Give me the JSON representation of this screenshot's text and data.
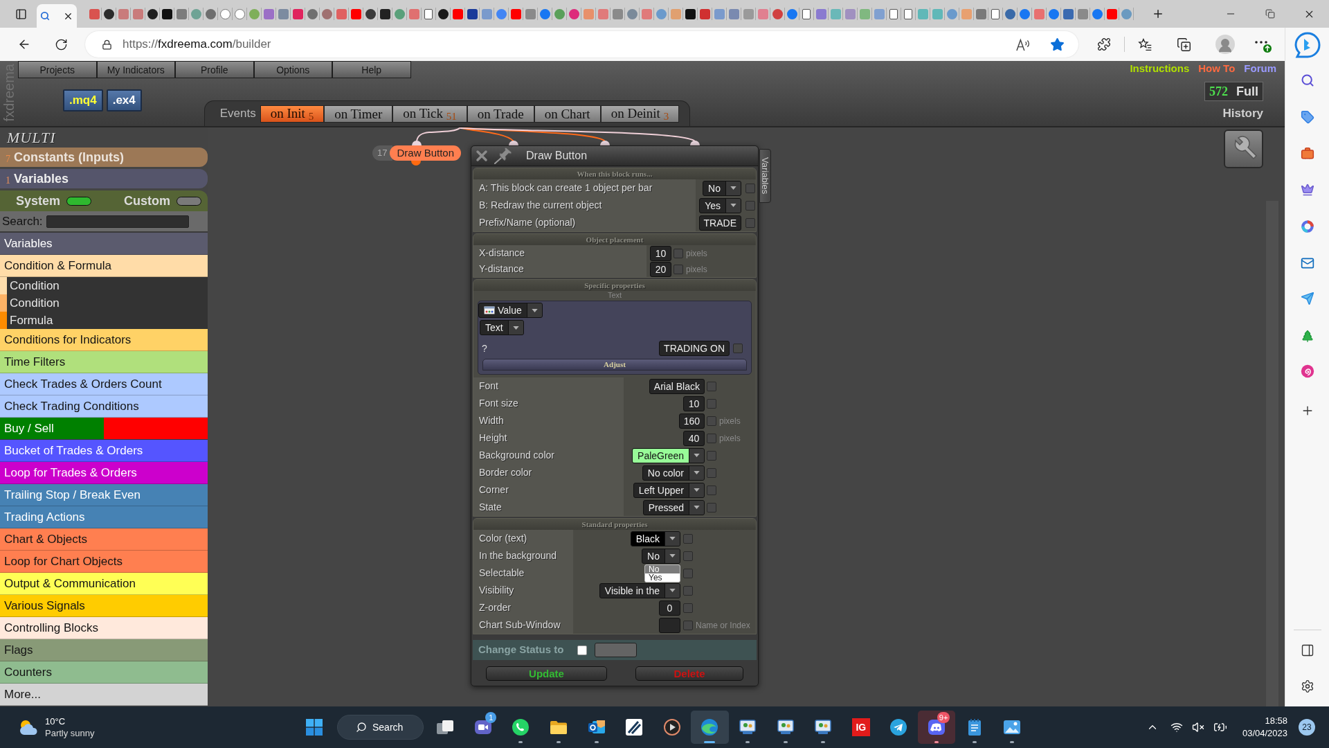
{
  "browser": {
    "favorited": true,
    "address": {
      "scheme": "https://",
      "host": "fxdreema.com",
      "path": "/builder"
    }
  },
  "header": {
    "brand": "fxdreema",
    "menu": [
      "Projects",
      "My Indicators",
      "Profile",
      "Options",
      "Help"
    ],
    "file_buttons": [
      {
        "label": ".mq4",
        "kind": "source"
      },
      {
        "label": ".ex4",
        "kind": "binary"
      }
    ],
    "links": [
      {
        "label": "Instructions",
        "color": "#b0e000"
      },
      {
        "label": "How To",
        "color": "#ff6a40"
      },
      {
        "label": "Forum",
        "color": "#9a9aff"
      }
    ],
    "counter": {
      "value": "572",
      "label": "Full"
    },
    "history": "History"
  },
  "events": {
    "label": "Events",
    "tabs": [
      {
        "label": "on Init",
        "count": "5",
        "selected": true
      },
      {
        "label": "on Timer",
        "selected": false
      },
      {
        "label": "on Tick",
        "count": "51",
        "selected": false
      },
      {
        "label": "on Trade",
        "selected": false
      },
      {
        "label": "on Chart",
        "selected": false
      },
      {
        "label": "on Deinit",
        "count": "3",
        "selected": false
      }
    ]
  },
  "sidebar": {
    "project": "MULTI",
    "constants": {
      "count": "7",
      "label": "Constants (Inputs)"
    },
    "variables": {
      "count": "1",
      "label": "Variables"
    },
    "toggles": [
      {
        "label": "System",
        "on": true
      },
      {
        "label": "Custom",
        "on": false
      }
    ],
    "search": {
      "label": "Search:"
    },
    "categories": [
      {
        "label": "Variables",
        "color": "#5b5b6e"
      },
      {
        "label": "Condition & Formula",
        "color": "#ffdca8",
        "expanded": true,
        "children": [
          {
            "label": "Condition",
            "color": "#ffdead"
          },
          {
            "label": "Condition",
            "color": "#ffb366"
          },
          {
            "label": "Formula",
            "color": "#ff8c00"
          }
        ]
      },
      {
        "label": "Conditions for Indicators",
        "color": "#ffd266"
      },
      {
        "label": "Time Filters",
        "color": "#b0e07c"
      },
      {
        "label": "Check Trades & Orders Count",
        "color": "#adc9ff"
      },
      {
        "label": "Check Trading Conditions",
        "color": "#adc9ff"
      },
      {
        "label": "Buy / Sell",
        "color": "#008000",
        "split": {
          "color": "#ff0000"
        }
      },
      {
        "label": "Bucket of Trades & Orders",
        "color": "#5555ff"
      },
      {
        "label": "Loop for Trades & Orders",
        "color": "#cc00cc"
      },
      {
        "label": "Trailing Stop / Break Even",
        "color": "#4682b4"
      },
      {
        "label": "Trading Actions",
        "color": "#4682b4"
      },
      {
        "label": "Chart & Objects",
        "color": "#ff7f50"
      },
      {
        "label": "Loop for Chart Objects",
        "color": "#ff7f50"
      },
      {
        "label": "Output & Communication",
        "color": "#ffff55"
      },
      {
        "label": "Various Signals",
        "color": "#ffcc00"
      },
      {
        "label": "Controlling Blocks",
        "color": "#ffe9dc"
      },
      {
        "label": "Flags",
        "color": "#889a77"
      },
      {
        "label": "Counters",
        "color": "#8fbc8f"
      },
      {
        "label": "More...",
        "color": "#d3d3d3"
      }
    ]
  },
  "canvas": {
    "node": {
      "number": "17",
      "label": "Draw Button"
    }
  },
  "dialog": {
    "title": "Draw Button",
    "side_tab": "Variables",
    "sections": [
      {
        "title": "When this block runs...",
        "rows": [
          {
            "kind": "select",
            "label": "A: This block can create 1 object per bar",
            "value": "No",
            "checked": false
          },
          {
            "kind": "select",
            "label": "B: Redraw the current object",
            "value": "Yes",
            "checked": false
          },
          {
            "kind": "input",
            "label": "Prefix/Name (optional)",
            "value": "TRADE",
            "checked": false
          }
        ]
      },
      {
        "title": "Object placement",
        "rows": [
          {
            "kind": "input",
            "label": "X-distance",
            "value": "10",
            "checked": false,
            "unit": "pixels"
          },
          {
            "kind": "input",
            "label": "Y-distance",
            "value": "20",
            "checked": false,
            "unit": "pixels"
          }
        ]
      },
      {
        "title": "Specific properties",
        "subtitle": "Text",
        "value_panel": {
          "source": "Value",
          "type": "Text",
          "hint": "?",
          "value": "TRADING ON",
          "checked": false,
          "adjust": "Adjust"
        },
        "rows": [
          {
            "kind": "input",
            "label": "Font",
            "value": "Arial Black",
            "checked": false
          },
          {
            "kind": "input",
            "label": "Font size",
            "value": "10",
            "checked": false
          },
          {
            "kind": "input",
            "label": "Width",
            "value": "160",
            "checked": false,
            "unit": "pixels"
          },
          {
            "kind": "input",
            "label": "Height",
            "value": "40",
            "checked": false,
            "unit": "pixels"
          },
          {
            "kind": "select",
            "label": "Background color",
            "value": "PaleGreen",
            "color": "#98fb98",
            "checked": false
          },
          {
            "kind": "select",
            "label": "Border color",
            "value": "No color",
            "checked": false
          },
          {
            "kind": "select",
            "label": "Corner",
            "value": "Left Upper",
            "checked": false
          },
          {
            "kind": "select",
            "label": "State",
            "value": "Pressed",
            "checked": false
          }
        ]
      },
      {
        "title": "Standard properties",
        "rows": [
          {
            "kind": "select",
            "label": "Color (text)",
            "value": "Black",
            "color": "#000000",
            "checked": false
          },
          {
            "kind": "select",
            "label": "In the background",
            "value": "No",
            "checked": false
          },
          {
            "kind": "select",
            "label": "Selectable",
            "open": true,
            "options": [
              {
                "label": "No",
                "selected": true
              },
              {
                "label": "Yes",
                "selected": false
              }
            ],
            "checked": false
          },
          {
            "kind": "select",
            "label": "Visibility",
            "value": "Visible in the",
            "checked": false
          },
          {
            "kind": "input",
            "label": "Z-order",
            "value": "0",
            "checked": false
          },
          {
            "kind": "input",
            "label": "Chart Sub-Window",
            "checked": false,
            "unit": "Name or Index"
          }
        ]
      }
    ],
    "change_status": {
      "label": "Change Status to",
      "checked": false
    },
    "buttons": [
      {
        "label": "Update",
        "color": "#33bb33"
      },
      {
        "label": "Delete",
        "color": "#cc1111"
      }
    ]
  },
  "taskbar": {
    "weather": {
      "temperature": "10°C",
      "condition": "Partly sunny"
    },
    "search": "Search",
    "apps": [
      {
        "kind": "taskview",
        "running": false,
        "selected": false,
        "alert": false
      },
      {
        "kind": "teams",
        "running": false,
        "selected": false,
        "alert": false,
        "badge": "1"
      },
      {
        "kind": "whatsapp",
        "running": true,
        "selected": false,
        "alert": false
      },
      {
        "kind": "folder",
        "running": true,
        "selected": false,
        "alert": false
      },
      {
        "kind": "outlook",
        "running": true,
        "selected": false,
        "alert": false
      },
      {
        "kind": "stylus",
        "running": false,
        "selected": false,
        "alert": false
      },
      {
        "kind": "player",
        "running": false,
        "selected": false,
        "alert": false
      },
      {
        "kind": "edge",
        "running": true,
        "selected": true,
        "alert": false
      },
      {
        "kind": "remote",
        "running": true,
        "selected": false,
        "alert": false
      },
      {
        "kind": "remote",
        "running": true,
        "selected": false,
        "alert": false
      },
      {
        "kind": "remote",
        "running": true,
        "selected": false,
        "alert": false
      },
      {
        "kind": "tile",
        "label": "IG",
        "running": false,
        "selected": false,
        "alert": false
      },
      {
        "kind": "telegram",
        "running": false,
        "selected": false,
        "alert": false
      },
      {
        "kind": "discord",
        "running": true,
        "selected": false,
        "alert": true,
        "badge": "9+"
      },
      {
        "kind": "notepad",
        "running": true,
        "selected": false,
        "alert": false
      },
      {
        "kind": "photos",
        "running": true,
        "selected": false,
        "alert": false
      }
    ],
    "clock": {
      "time": "18:58",
      "date": "03/04/2023"
    },
    "notifications": "23"
  }
}
